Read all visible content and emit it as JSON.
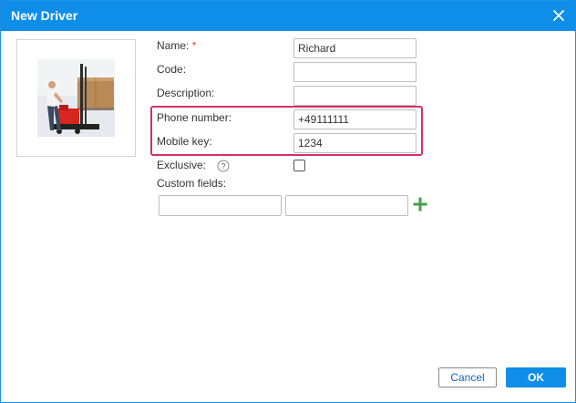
{
  "dialog": {
    "title": "New Driver",
    "close_icon": "close-icon"
  },
  "photo": {
    "description_icon": "forklift-driver-photo"
  },
  "form": {
    "name_label": "Name:",
    "required_marker": "*",
    "name_value": "Richard",
    "code_label": "Code:",
    "code_value": "",
    "description_label": "Description:",
    "description_value": "",
    "phone_label": "Phone number:",
    "phone_value": "+49111111",
    "mobile_key_label": "Mobile key:",
    "mobile_key_value": "1234",
    "exclusive_label": "Exclusive:",
    "exclusive_checked": false,
    "help_icon": "question-circle-icon",
    "custom_fields_label": "Custom fields:",
    "custom_field_key": "",
    "custom_field_value": "",
    "add_icon": "plus-icon"
  },
  "colors": {
    "accent": "#0f8ee9",
    "highlight": "#d4306b",
    "add": "#43a047",
    "required": "#e53935"
  },
  "buttons": {
    "cancel_label": "Cancel",
    "ok_label": "OK"
  }
}
